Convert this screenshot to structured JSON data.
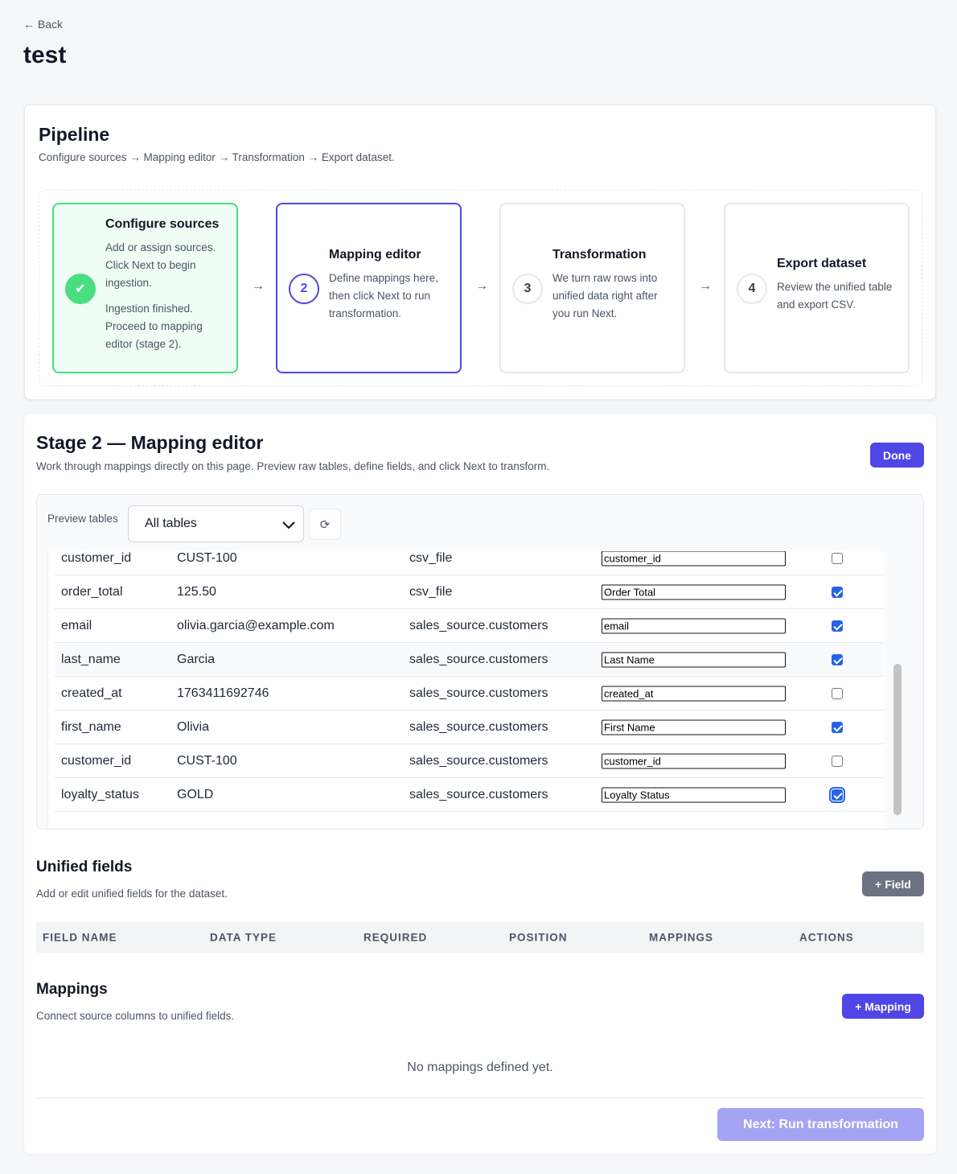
{
  "header": {
    "back_label": "← Back",
    "title": "test"
  },
  "pipeline": {
    "title": "Pipeline",
    "subtitle": "Configure sources → Mapping editor → Transformation → Export dataset.",
    "steps": [
      {
        "badge": "✔",
        "title": "Configure sources",
        "desc": "Add or assign sources. Click Next to begin ingestion.",
        "note": "Ingestion finished. Proceed to mapping editor (stage 2)."
      },
      {
        "badge": "2",
        "title": "Mapping editor",
        "desc": "Define mappings here, then click Next to run transformation."
      },
      {
        "badge": "3",
        "title": "Transformation",
        "desc": "We turn raw rows into unified data right after you run Next."
      },
      {
        "badge": "4",
        "title": "Export dataset",
        "desc": "Review the unified table and export CSV."
      }
    ],
    "arrow": "→"
  },
  "stage": {
    "title": "Stage 2 — Mapping editor",
    "subtitle": "Work through mappings directly on this page. Preview raw tables, define fields, and click Next to transform.",
    "done_label": "Done",
    "preview": {
      "label": "Preview tables",
      "selected": "All tables",
      "refresh_icon": "⟳",
      "rows": [
        {
          "column": "customer_id",
          "value": "CUST-100",
          "source": "csv_file",
          "mapped": "customer_id",
          "checked": false
        },
        {
          "column": "order_total",
          "value": "125.50",
          "source": "csv_file",
          "mapped": "Order Total",
          "checked": true
        },
        {
          "column": "email",
          "value": "olivia.garcia@example.com",
          "source": "sales_source.customers",
          "mapped": "email",
          "checked": true
        },
        {
          "column": "last_name",
          "value": "Garcia",
          "source": "sales_source.customers",
          "mapped": "Last Name",
          "checked": true
        },
        {
          "column": "created_at",
          "value": "1763411692746",
          "source": "sales_source.customers",
          "mapped": "created_at",
          "checked": false
        },
        {
          "column": "first_name",
          "value": "Olivia",
          "source": "sales_source.customers",
          "mapped": "First Name",
          "checked": true
        },
        {
          "column": "customer_id",
          "value": "CUST-100",
          "source": "sales_source.customers",
          "mapped": "customer_id",
          "checked": false
        },
        {
          "column": "loyalty_status",
          "value": "GOLD",
          "source": "sales_source.customers",
          "mapped": "Loyalty Status",
          "checked": true
        }
      ]
    },
    "unified": {
      "title": "Unified fields",
      "subtitle": "Add or edit unified fields for the dataset.",
      "add_label": "+ Field",
      "columns": [
        "FIELD NAME",
        "DATA TYPE",
        "REQUIRED",
        "POSITION",
        "MAPPINGS",
        "ACTIONS"
      ]
    },
    "mappings": {
      "title": "Mappings",
      "subtitle": "Connect source columns to unified fields.",
      "add_label": "+ Mapping",
      "empty": "No mappings defined yet."
    },
    "next_label": "Next: Run transformation"
  }
}
